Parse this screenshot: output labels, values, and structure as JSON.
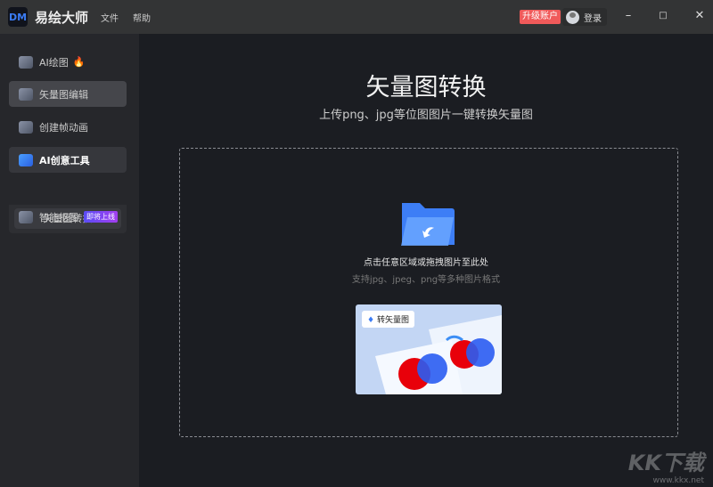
{
  "app": {
    "logo": "DM",
    "name": "易绘大师",
    "menu": [
      "文件",
      "帮助"
    ],
    "upgrade": "升级账户",
    "login": "登录"
  },
  "sidebar": {
    "items": [
      {
        "label": "AI绘图"
      },
      {
        "label": "矢量图编辑"
      },
      {
        "label": "创建帧动画"
      },
      {
        "label": "AI创意工具"
      },
      {
        "label": "智能抠图",
        "badge": "即将上线"
      }
    ],
    "subitem": "矢量图转换"
  },
  "main": {
    "title": "矢量图转换",
    "subtitle": "上传png、jpg等位图图片一键转换矢量图",
    "drop_hint": "点击任意区域或拖拽图片至此处",
    "formats": "支持jpg、jpeg、png等多种图片格式",
    "preview_tag": "转矢量图"
  },
  "watermark": {
    "brand": "KK下载",
    "url": "www.kkx.net"
  },
  "colors": {
    "accent": "#3b7cf5",
    "upgrade": "#f05a5a"
  }
}
